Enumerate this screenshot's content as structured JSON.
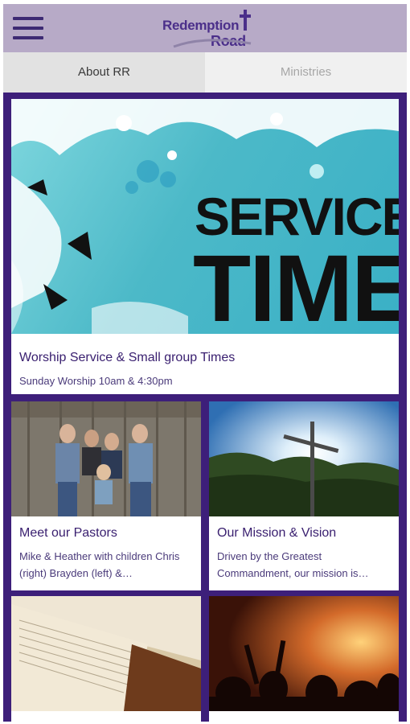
{
  "app": {
    "logo_line1": "Redemption",
    "logo_line2": "Road"
  },
  "tabs": [
    {
      "label": "About RR",
      "active": true
    },
    {
      "label": "Ministries",
      "active": false
    }
  ],
  "hero": {
    "image_text_1": "SERVICE",
    "image_text_2": "TIMES",
    "title": "Worship Service & Small group Times",
    "subtitle": "Sunday Worship 10am & 4:30pm"
  },
  "cards": [
    {
      "title": "Meet our Pastors",
      "subtitle": "Mike & Heather with children Chris (right) Brayden (left) &…"
    },
    {
      "title": "Our Mission & Vision",
      "subtitle": "Driven by the Greatest Commandment, our mission is…"
    },
    {
      "title": "",
      "subtitle": ""
    },
    {
      "title": "",
      "subtitle": ""
    }
  ],
  "colors": {
    "appbar": "#b7aac7",
    "brand_purple": "#3d1f7a",
    "tab_active_bg": "#e2e2e2",
    "tab_inactive_text": "#a7a7a7"
  },
  "icons": [
    "hamburger-menu-icon",
    "cross-icon"
  ]
}
